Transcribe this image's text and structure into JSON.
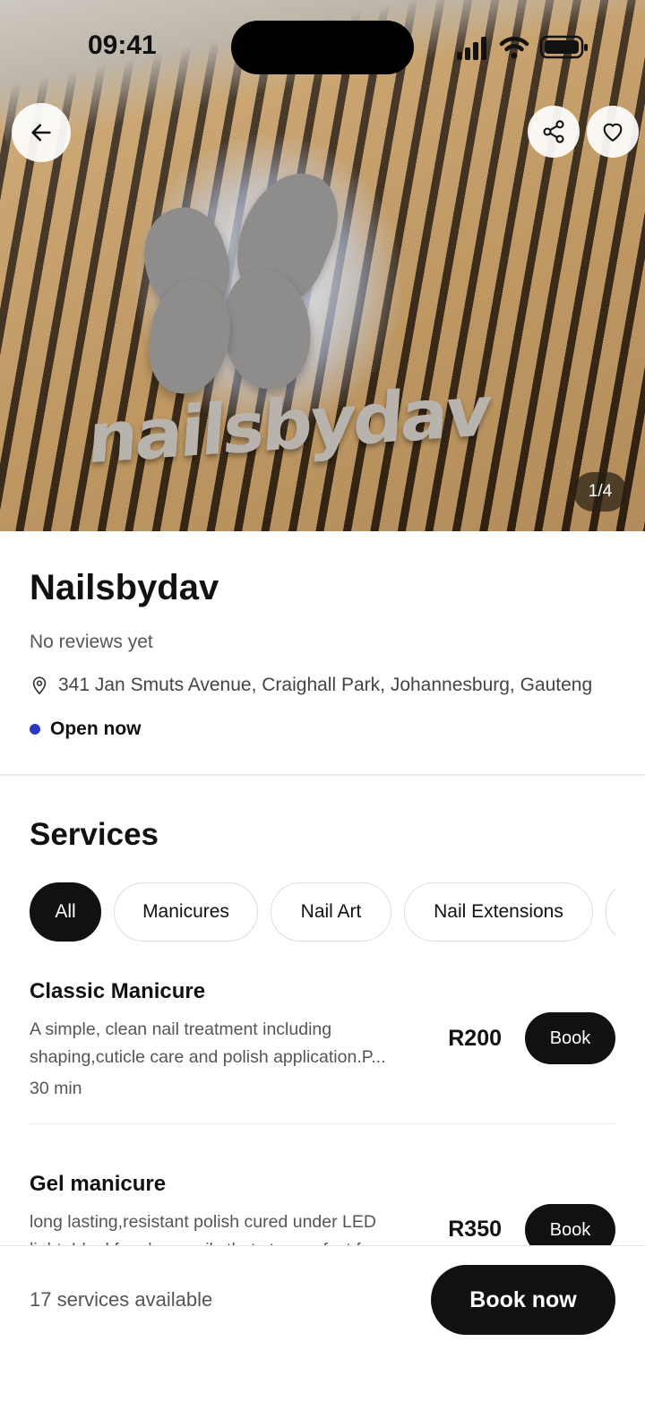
{
  "status_bar": {
    "time": "09:41"
  },
  "hero": {
    "logo_text": "nailsbydav",
    "photo_counter": "1/4"
  },
  "shop": {
    "name": "Nailsbydav",
    "reviews": "No reviews yet",
    "address": "341 Jan Smuts Avenue, Craighall Park, Johannesburg, Gauteng",
    "open_status": "Open now",
    "open_color": "#2a3bc2"
  },
  "services": {
    "title": "Services",
    "chips": [
      {
        "label": "All",
        "active": true
      },
      {
        "label": "Manicures",
        "active": false
      },
      {
        "label": "Nail Art",
        "active": false
      },
      {
        "label": "Nail Extensions",
        "active": false
      },
      {
        "label": "",
        "active": false
      }
    ],
    "items": [
      {
        "name": "Classic Manicure",
        "desc_line1": "A simple, clean nail treatment including",
        "desc_line2": "shaping,cuticle care and polish application.P...",
        "duration": "30 min",
        "price": "R200",
        "book_label": "Book"
      },
      {
        "name": "Gel manicure",
        "desc_line1": "long lasting,resistant polish cured under LED",
        "desc_line2": "light. Ideal for clean nails that stay perfect f...",
        "duration": "",
        "price": "R350",
        "book_label": "Book"
      }
    ]
  },
  "bottom_bar": {
    "count_text": "17 services available",
    "book_now_label": "Book now"
  }
}
